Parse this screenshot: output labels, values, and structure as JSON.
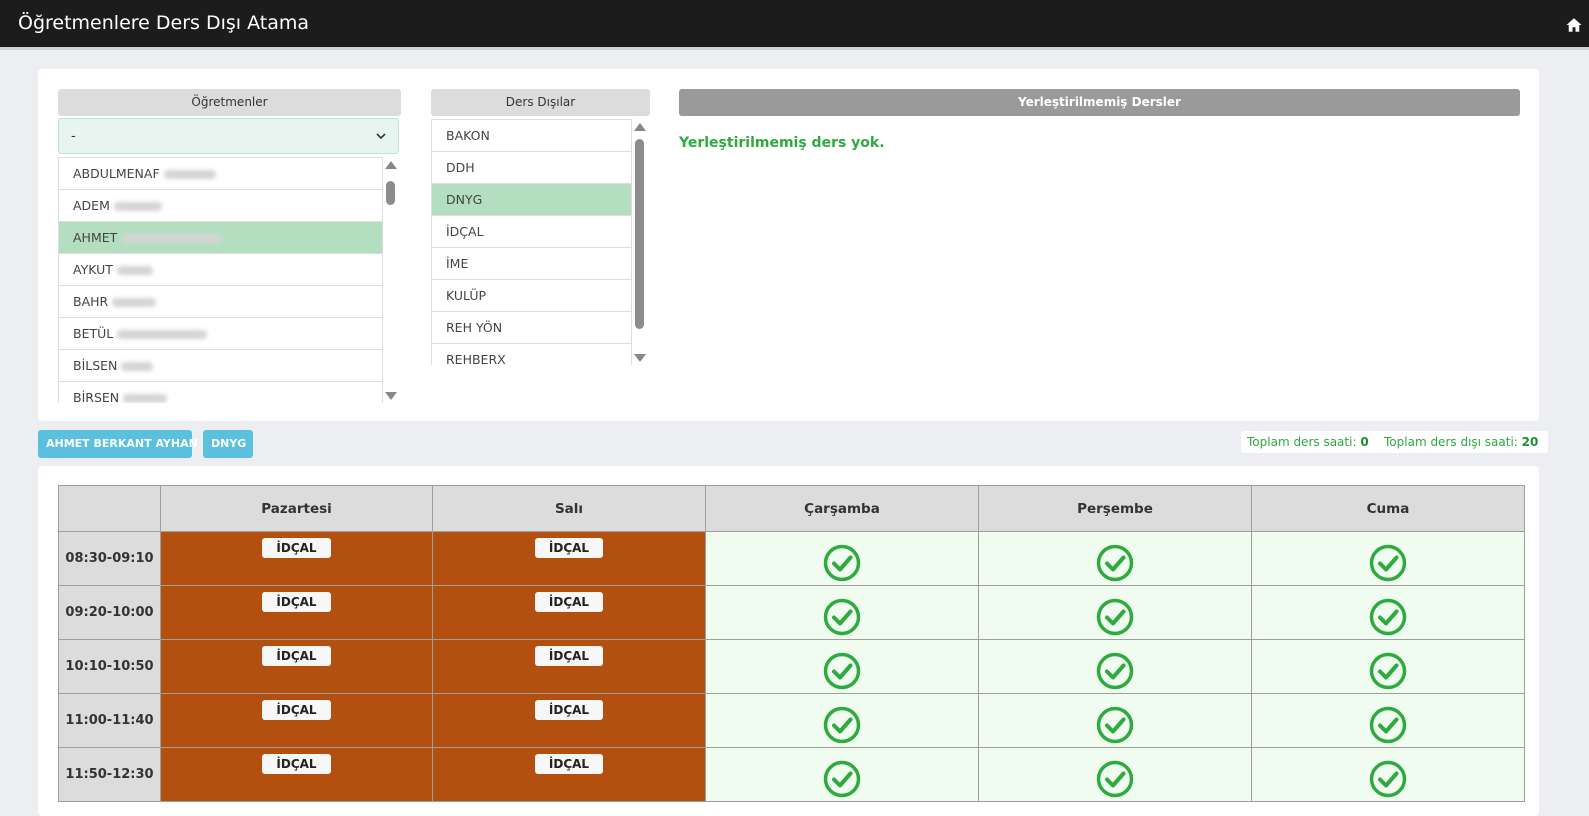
{
  "header": {
    "title": "Öğretmenlere Ders Dışı Atama",
    "home_icon": "home-icon"
  },
  "teachers_panel": {
    "heading": "Öğretmenler",
    "select_value": "-",
    "items": [
      {
        "label": "ABDULMENAF",
        "selected": false
      },
      {
        "label": "ADEM",
        "selected": false
      },
      {
        "label": "AHMET",
        "selected": true
      },
      {
        "label": "AYKUT",
        "selected": false
      },
      {
        "label": "BAHR",
        "selected": false
      },
      {
        "label": "BETÜL",
        "selected": false
      },
      {
        "label": "BİLSEN",
        "selected": false
      },
      {
        "label": "BİRSEN",
        "selected": false
      }
    ]
  },
  "ders_panel": {
    "heading": "Ders Dışılar",
    "items": [
      {
        "label": "BAKON",
        "selected": false
      },
      {
        "label": "DDH",
        "selected": false
      },
      {
        "label": "DNYG",
        "selected": true
      },
      {
        "label": "İDÇAL",
        "selected": false
      },
      {
        "label": "İME",
        "selected": false
      },
      {
        "label": "KULÜP",
        "selected": false
      },
      {
        "label": "REH YÖN",
        "selected": false
      },
      {
        "label": "REHBERX",
        "selected": false
      }
    ]
  },
  "unplaced_panel": {
    "heading": "Yerleştirilmemiş Dersler",
    "message": "Yerleştirilmemiş ders yok."
  },
  "selection": {
    "teacher_chip": "AHMET BERKANT AYHAN",
    "ders_chip": "DNYG"
  },
  "totals": {
    "ders_label": "Toplam ders saati:",
    "ders_value": "0",
    "dersdisi_label": "Toplam ders dışı saati:",
    "dersdisi_value": "20"
  },
  "schedule": {
    "days": [
      "Pazartesi",
      "Salı",
      "Çarşamba",
      "Perşembe",
      "Cuma"
    ],
    "rows": [
      {
        "time": "08:30-09:10",
        "cells": [
          "İDÇAL",
          "İDÇAL",
          "",
          "",
          ""
        ]
      },
      {
        "time": "09:20-10:00",
        "cells": [
          "İDÇAL",
          "İDÇAL",
          "",
          "",
          ""
        ]
      },
      {
        "time": "10:10-10:50",
        "cells": [
          "İDÇAL",
          "İDÇAL",
          "",
          "",
          ""
        ]
      },
      {
        "time": "11:00-11:40",
        "cells": [
          "İDÇAL",
          "İDÇAL",
          "",
          "",
          ""
        ]
      },
      {
        "time": "11:50-12:30",
        "cells": [
          "İDÇAL",
          "İDÇAL",
          "",
          "",
          ""
        ]
      }
    ],
    "busy_color": "#b4500f",
    "free_color": "#effcef",
    "check_color": "#2eaa3f"
  }
}
